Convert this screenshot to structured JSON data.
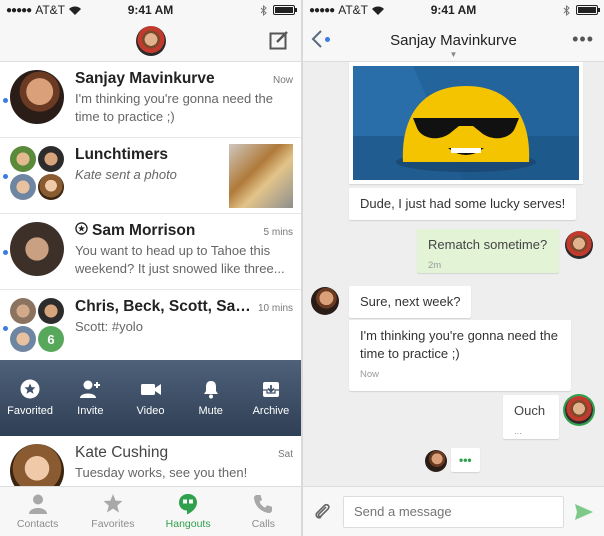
{
  "status_bar": {
    "carrier": "AT&T",
    "time": "9:41 AM"
  },
  "conversations": [
    {
      "name": "Sanjay Mavinkurve",
      "time": "Now",
      "snippet": "I'm thinking you're gonna need the time to practice ;)",
      "unread": true
    },
    {
      "name": "Lunchtimers",
      "time": "",
      "snippet": "Kate sent a photo",
      "unread": true
    },
    {
      "name": "Sam Morrison",
      "time": "5 mins",
      "snippet": "You want to head up to Tahoe this weekend? It just snowed like three...",
      "unread": true
    },
    {
      "name": "Chris, Beck, Scott, Sahil...",
      "time": "10 mins",
      "snippet": "Scott: #yolo",
      "unread": true,
      "extra_count": "6"
    },
    {
      "name": "Kate Cushing",
      "time": "Sat",
      "snippet": "Tuesday works, see you then!"
    }
  ],
  "actions": [
    {
      "label": "Favorited",
      "icon": "star-circle-icon"
    },
    {
      "label": "Invite",
      "icon": "add-person-icon"
    },
    {
      "label": "Video",
      "icon": "video-camera-icon"
    },
    {
      "label": "Mute",
      "icon": "bell-icon"
    },
    {
      "label": "Archive",
      "icon": "archive-box-icon"
    }
  ],
  "bottom_nav": [
    {
      "label": "Contacts",
      "icon": "person-icon"
    },
    {
      "label": "Favorites",
      "icon": "star-icon"
    },
    {
      "label": "Hangouts",
      "icon": "hangouts-quote-icon",
      "active": true
    },
    {
      "label": "Calls",
      "icon": "phone-icon"
    }
  ],
  "chat": {
    "title": "Sanjay Mavinkurve",
    "messages": [
      {
        "from": "them",
        "text": "Dude, I just had some lucky serves!"
      },
      {
        "from": "me",
        "text": "Rematch sometime?",
        "meta": "2m"
      },
      {
        "from": "them",
        "text": "Sure, next week?"
      },
      {
        "from": "them",
        "text": "I'm thinking you're gonna need the time to practice ;)",
        "meta": "Now"
      },
      {
        "from": "me",
        "text": "Ouch",
        "meta": "..."
      }
    ],
    "typing": "•••",
    "composer_placeholder": "Send a message"
  },
  "colors": {
    "accent_green": "#2fa04b",
    "unread_blue": "#3b7be2",
    "action_bar": "#3e506a",
    "my_bubble": "#e2f3d6"
  }
}
